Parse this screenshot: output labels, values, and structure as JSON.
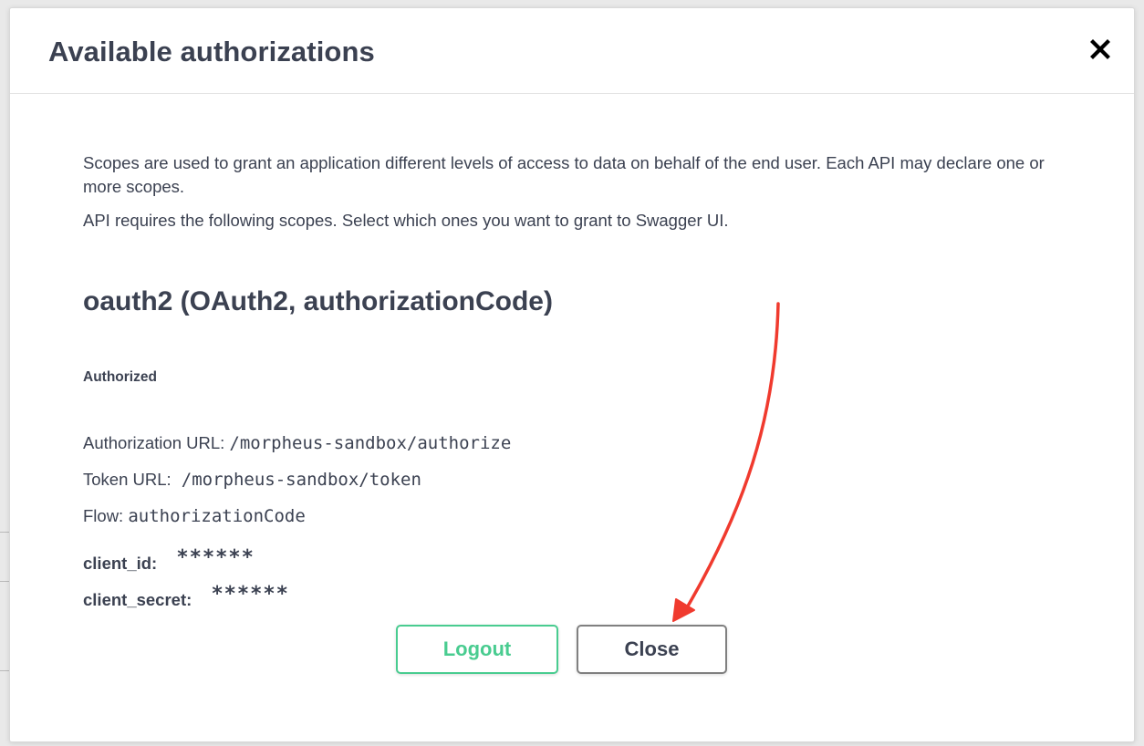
{
  "modal": {
    "title": "Available authorizations",
    "close_icon": "close-x-icon"
  },
  "body": {
    "description_1": "Scopes are used to grant an application different levels of access to data on behalf of the end user. Each API may declare one or more scopes.",
    "description_2": "API requires the following scopes. Select which ones you want to grant to Swagger UI.",
    "scheme_title": "oauth2 (OAuth2, authorizationCode)",
    "status": "Authorized",
    "authorization_url_label": "Authorization URL:",
    "authorization_url_value": "/morpheus-sandbox/authorize",
    "token_url_label": "Token URL:",
    "token_url_value": "/morpheus-sandbox/token",
    "flow_label": "Flow:",
    "flow_value": "authorizationCode",
    "client_id_label": "client_id:",
    "client_id_value": "******",
    "client_secret_label": "client_secret:",
    "client_secret_value": "******"
  },
  "buttons": {
    "logout_label": "Logout",
    "close_label": "Close"
  },
  "colors": {
    "text": "#3b4151",
    "logout_green": "#49cc90",
    "close_border": "#808080",
    "annotation_arrow": "#f03a2e"
  }
}
